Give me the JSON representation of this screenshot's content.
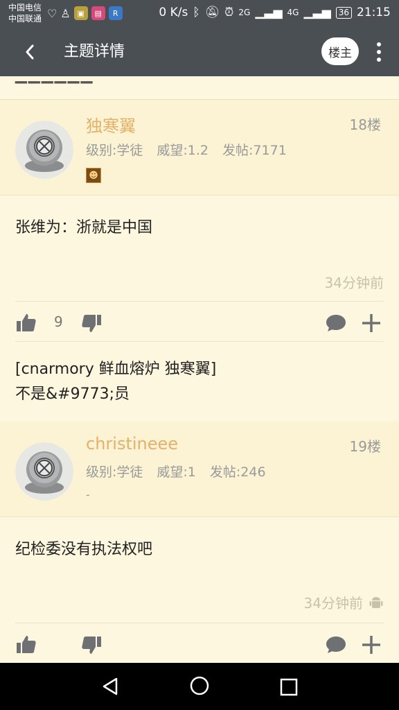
{
  "statusbar": {
    "carrier1": "中国电信",
    "carrier2": "中国联通",
    "speed": "0 K/s",
    "net1": "2G",
    "net2": "4G",
    "battery": "36",
    "time": "21:15"
  },
  "appbar": {
    "title": "主题详情",
    "owner_filter_label": "楼主"
  },
  "posts": [
    {
      "username": "独寒翼",
      "floor": "18楼",
      "level": "级别:学徒",
      "reputation": "威望:1.2",
      "post_count": "发帖:7171",
      "content": "张维为：浙就是中国",
      "time": "34分钟前",
      "likes": "9",
      "quote_line1": "[cnarmory 鲜血熔炉 独寒翼]",
      "quote_line2": "不是&#9773;员"
    },
    {
      "username": "christineee",
      "floor": "19楼",
      "level": "级别:学徒",
      "reputation": "威望:1",
      "post_count": "发帖:246",
      "signature": "-",
      "content": "纪检委没有执法权吧",
      "time": "34分钟前"
    }
  ],
  "colors": {
    "appbar": "#4a4f54",
    "page_bg": "#fdf7df",
    "header_bg": "#fcf3d4",
    "username": "#e4b06a",
    "icon": "#6f7074"
  }
}
